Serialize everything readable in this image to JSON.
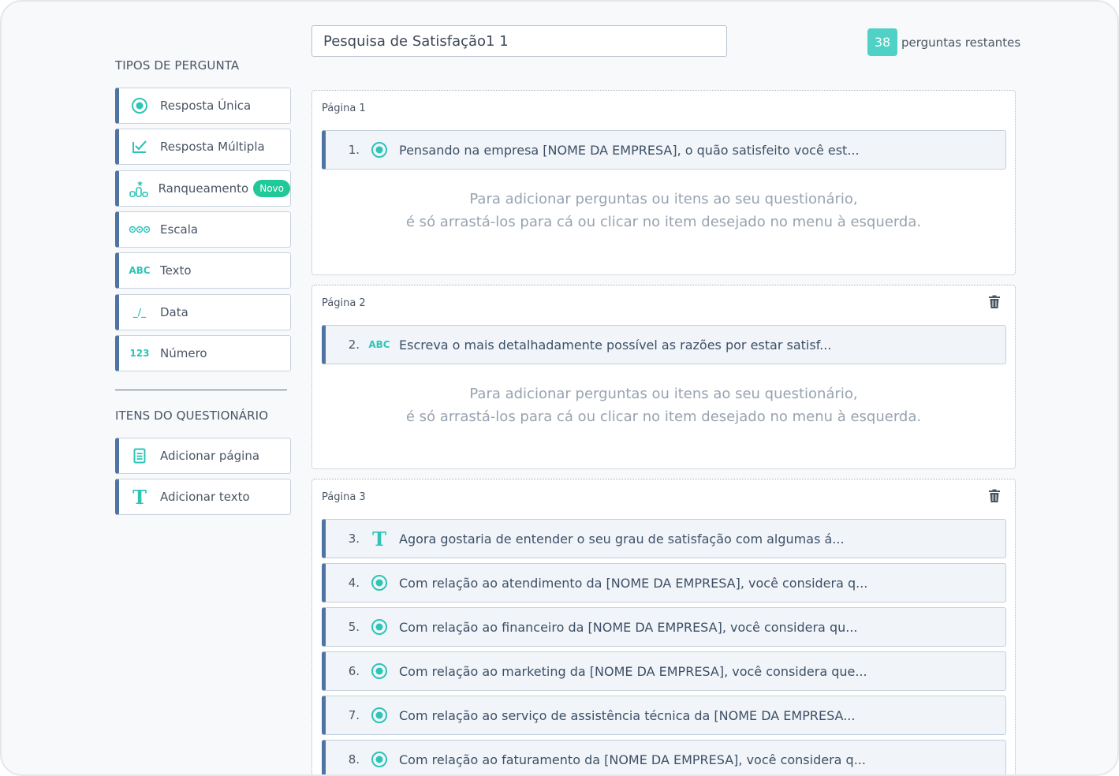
{
  "survey": {
    "title": "Pesquisa de Satisfação1 1",
    "remaining_count": "38",
    "remaining_label": "perguntas restantes"
  },
  "sidebar": {
    "question_types_title": "TIPOS DE PERGUNTA",
    "types": [
      {
        "label": "Resposta Única",
        "icon": "radio-icon"
      },
      {
        "label": "Resposta  Múltipla",
        "icon": "checkbox-icon"
      },
      {
        "label": "Ranqueamento",
        "icon": "ranking-icon",
        "badge": "Novo"
      },
      {
        "label": "Escala",
        "icon": "scale-icon"
      },
      {
        "label": "Texto",
        "icon": "text-abc-icon",
        "icon_text": "ABC"
      },
      {
        "label": "Data",
        "icon": "date-icon",
        "icon_text": "_/_"
      },
      {
        "label": "Número",
        "icon": "number-icon",
        "icon_text": "123"
      }
    ],
    "items_title": "ITENS DO QUESTIONÁRIO",
    "items": [
      {
        "label": "Adicionar página",
        "icon": "page-icon"
      },
      {
        "label": "Adicionar texto",
        "icon": "text-t-icon",
        "icon_text": "T"
      }
    ]
  },
  "hint": {
    "line1": "Para adicionar perguntas ou itens ao seu questionário,",
    "line2": "é só arrastá-los para cá ou clicar no item desejado no menu à esquerda."
  },
  "pages": [
    {
      "label": "Página 1",
      "questions": [
        {
          "num": "1.",
          "type": "radio-icon",
          "text": "Pensando na empresa [NOME DA EMPRESA], o quão satisfeito você est..."
        }
      ]
    },
    {
      "label": "Página 2",
      "questions": [
        {
          "num": "2.",
          "type": "text-abc-icon",
          "icon_text": "ABC",
          "text": "Escreva o mais detalhadamente possível as razões por estar satisf..."
        }
      ]
    },
    {
      "label": "Página 3",
      "questions": [
        {
          "num": "3.",
          "type": "text-t-icon",
          "icon_text": "T",
          "text": "Agora gostaria de entender o seu grau de satisfação com algumas á..."
        },
        {
          "num": "4.",
          "type": "radio-icon",
          "text": "Com relação ao atendimento da [NOME DA EMPRESA], você considera q..."
        },
        {
          "num": "5.",
          "type": "radio-icon",
          "text": "Com relação ao financeiro da [NOME DA EMPRESA], você considera qu..."
        },
        {
          "num": "6.",
          "type": "radio-icon",
          "text": "Com relação ao marketing da [NOME DA EMPRESA], você considera que..."
        },
        {
          "num": "7.",
          "type": "radio-icon",
          "text": "Com relação ao serviço de assistência técnica da [NOME DA EMPRESA..."
        },
        {
          "num": "8.",
          "type": "radio-icon",
          "text": "Com relação ao faturamento da [NOME DA EMPRESA], você considera q..."
        }
      ]
    }
  ],
  "colors": {
    "accent": "#2ec4b6",
    "border_accent": "#4f73a3",
    "badge_new": "#20c997",
    "count_badge": "#4fd1c5"
  }
}
